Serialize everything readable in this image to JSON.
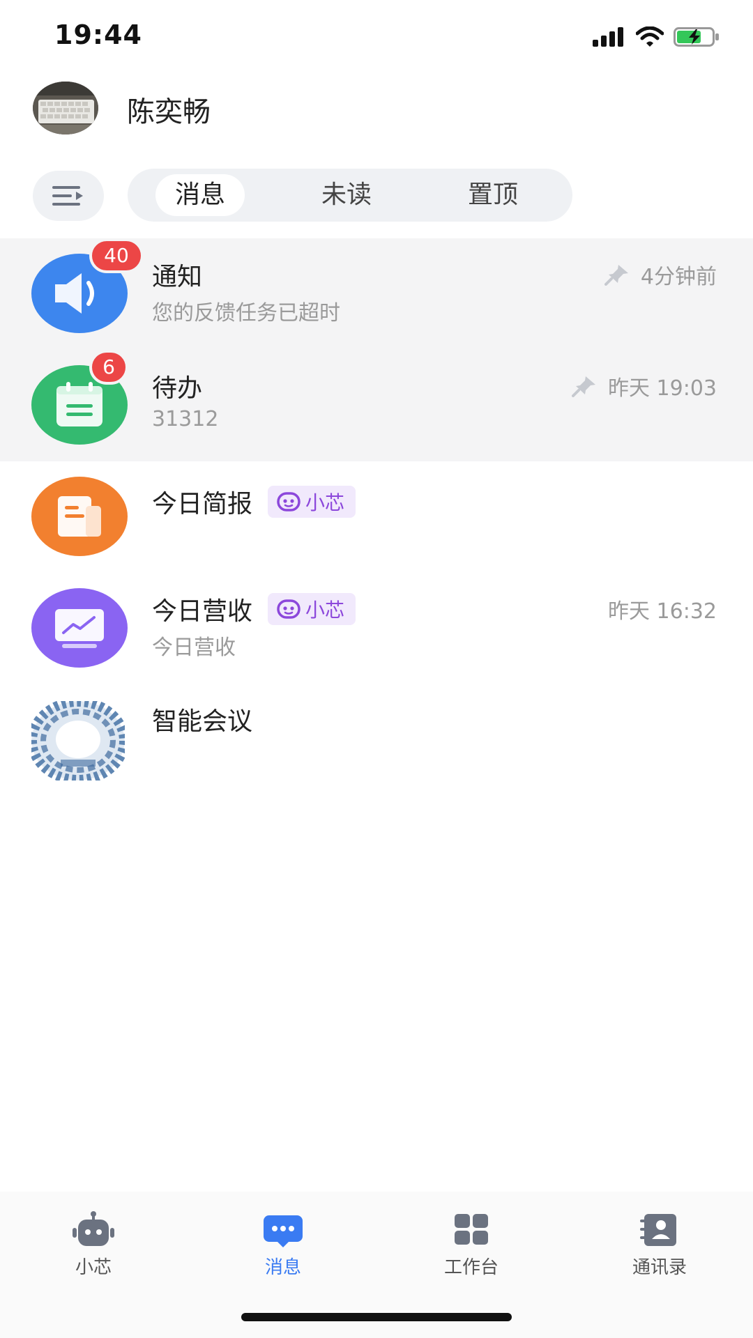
{
  "status_bar": {
    "time": "19:44",
    "icons": [
      "signal-icon",
      "wifi-icon",
      "battery-charging-icon"
    ]
  },
  "header": {
    "user_name": "陈奕畅"
  },
  "filter_tabs": {
    "items": [
      "消息",
      "未读",
      "置顶"
    ],
    "selected": "消息"
  },
  "conversations": [
    {
      "title": "通知",
      "subtitle": "您的反馈任务已超时",
      "time": "4分钟前",
      "badge": "40",
      "pinned": true,
      "icon": "speaker-icon",
      "color": "#3d86ee"
    },
    {
      "title": "待办",
      "subtitle": "31312",
      "time": "昨天 19:03",
      "badge": "6",
      "pinned": true,
      "icon": "calendar-icon",
      "color": "#34ba70"
    },
    {
      "title": "今日简报",
      "tag": "小芯",
      "icon": "report-icon",
      "color": "#f2802f"
    },
    {
      "title": "今日营收",
      "tag": "小芯",
      "subtitle": "今日营收",
      "time": "昨天 16:32",
      "icon": "monitor-chart-icon",
      "color": "#8a64f2"
    },
    {
      "title": "智能会议",
      "icon": "meeting-avatar-icon"
    }
  ],
  "tab_bar": {
    "items": [
      {
        "label": "小芯",
        "icon": "robot-icon"
      },
      {
        "label": "消息",
        "icon": "chat-icon"
      },
      {
        "label": "工作台",
        "icon": "grid-icon"
      },
      {
        "label": "通讯录",
        "icon": "contacts-icon"
      }
    ],
    "active": "消息",
    "active_color": "#3a7bf2"
  }
}
